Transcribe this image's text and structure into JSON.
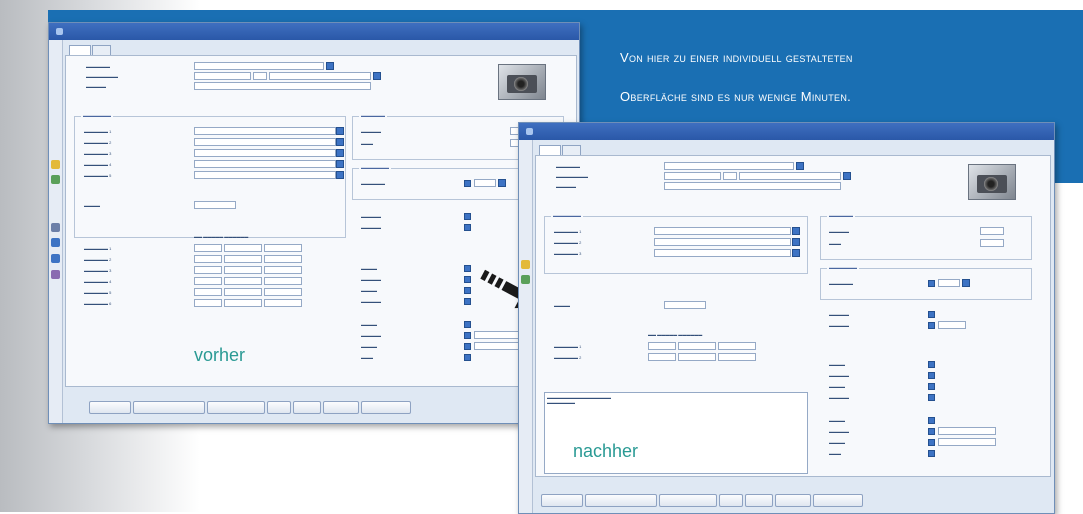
{
  "caption": {
    "line1": "Von hier zu einer individuell gestalteten",
    "line2": "Oberfläche sind es nur wenige Minuten."
  },
  "labels": {
    "before": "vorher",
    "after": "nachher"
  },
  "colors": {
    "banner": "#1a6fb3",
    "titlebar": "#2a58a8",
    "label_teal": "#2a9a94",
    "caption_text": "#ffffff"
  },
  "icons": {
    "arrow": "arrow-right-icon",
    "product_image": "camera-icon"
  }
}
